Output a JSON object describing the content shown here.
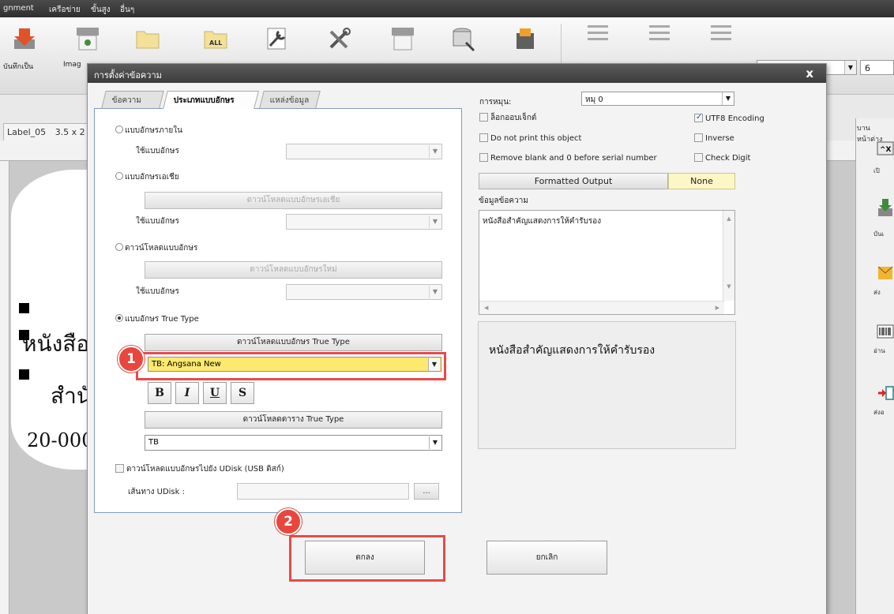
{
  "menubar": {
    "items": [
      "gnment",
      "เครือข่าย",
      "ขั้นสูง",
      "อื่นๆ"
    ]
  },
  "ribbon": {
    "labels": [
      "บันทึกเป็น",
      "Imag"
    ],
    "font_size_value": "6"
  },
  "document": {
    "tab_name": "Label_05",
    "tab_size": "3.5 x 2",
    "canvas_texts": [
      "หนังสือ",
      "สำนั",
      "20-000"
    ]
  },
  "right_panel": {
    "title": "บานหน้าต่าง",
    "captions": [
      "เปิ",
      "บันเ",
      "ส่ง",
      "อ่าน",
      "ส่งอ"
    ]
  },
  "dialog": {
    "title": "การตั้งค่าข้อความ",
    "close_glyph": "x",
    "tabs": [
      "ข้อความ",
      "ประเภทแบบอักษร",
      "แหล่งข้อมูล"
    ],
    "left": {
      "builtin_font_radio": "แบบอักษรภายใน",
      "builtin_use_font_label": "ใช้แบบอักษร",
      "asian_font_radio": "แบบอักษรเอเชีย",
      "asian_download_button": "ดาวน์โหลดแบบอักษรเอเชีย",
      "asian_use_font_label": "ใช้แบบอักษร",
      "download_font_radio": "ดาวน์โหลดแบบอักษร",
      "new_font_download_button": "ดาวน์โหลดแบบอักษรใหม่",
      "download_use_font_label": "ใช้แบบอักษร",
      "truetype_radio": "แบบอักษร True Type",
      "truetype_download_button": "ดาวน์โหลดแบบอักษร True Type",
      "truetype_font_value": "TB: Angsana New",
      "format_buttons": [
        "B",
        "I",
        "U",
        "S"
      ],
      "truetype_table_download_button": "ดาวน์โหลดตาราง True Type",
      "truetype_table_value": "TB",
      "udisk_checkbox": "ดาวน์โหลดแบบอักษรไปยัง UDisk (USB ดิสก์)",
      "udisk_path_label": "เส้นทาง UDisk :",
      "browse_button": "..."
    },
    "right": {
      "rotation_label": "การหมุน:",
      "rotation_value": "หมุ 0",
      "lock_object": "ล็อกออบเจ็กต์",
      "utf8_encoding": "UTF8 Encoding",
      "do_not_print": "Do not print this object",
      "inverse": "Inverse",
      "remove_blank": "Remove blank and 0 before serial number",
      "check_digit": "Check Digit",
      "formatted_output_button": "Formatted Output",
      "formatted_output_value": "None",
      "text_data_label": "ข้อมูลข้อความ",
      "text_data_value": "หนังสือสำคัญแสดงการให้คำรับรอง",
      "preview_text": "หนังสือสำคัญแสดงการให้คำรับรอง"
    },
    "ok_button": "ตกลง",
    "cancel_button": "ยกเลิก"
  },
  "annotations": {
    "badge_1": "1",
    "badge_2": "2"
  },
  "colors": {
    "annotation_red": "#e84a4a",
    "formatted_value_bg": "#fdf6c6",
    "truetype_select_bg": "#fde96e"
  }
}
